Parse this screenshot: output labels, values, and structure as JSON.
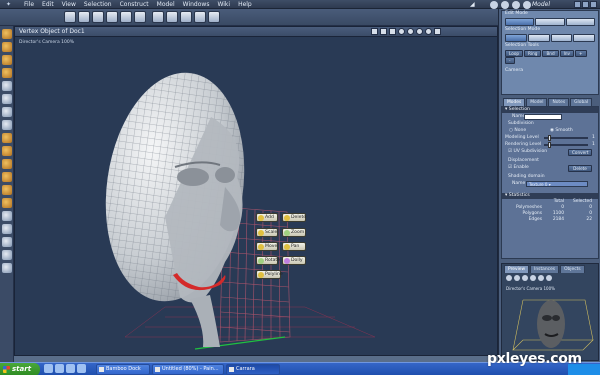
{
  "menubar": {
    "items": [
      "File",
      "Edit",
      "View",
      "Selection",
      "Construct",
      "Model",
      "Windows",
      "Wiki",
      "Help"
    ],
    "mode_label": "Model"
  },
  "viewport": {
    "title": "Vertex Object of Doc1",
    "camera_label": "Director's Camera 100%"
  },
  "popup_menu": {
    "items": [
      {
        "label": "Add",
        "color": "#e0c040"
      },
      {
        "label": "Delete",
        "color": "#e0c040"
      },
      {
        "label": "Scale",
        "color": "#e0c040"
      },
      {
        "label": "Zoom",
        "color": "#a0d080"
      },
      {
        "label": "Move",
        "color": "#e0c040"
      },
      {
        "label": "Pan",
        "color": "#e0c040"
      },
      {
        "label": "Rotate",
        "color": "#a0d080"
      },
      {
        "label": "Dolly",
        "color": "#c080e0"
      },
      {
        "label": "Polyline",
        "color": "#e0c040"
      }
    ]
  },
  "right_panel": {
    "edit_mode_label": "Edit Mode",
    "selection_mode_label": "Selection Mode",
    "selection_tools_label": "Selection Tools",
    "selection_tools": [
      "Loop",
      "Ring",
      "Bnd",
      "Inv",
      "+",
      "-"
    ],
    "camera_label": "Camera",
    "tabs": [
      "Modes",
      "Model",
      "Notes",
      "Global"
    ],
    "selection_section": "Selection",
    "name_label": "Name",
    "name_value": "",
    "subdivision_label": "Subdivision",
    "subdivision_none": "None",
    "subdivision_smooth": "Smooth",
    "modeling_level_label": "Modeling Level",
    "modeling_level_value": "1",
    "rendering_level_label": "Rendering Level",
    "rendering_level_value": "1",
    "uv_subdivision_label": "UV Subdivision",
    "convert_label": "Convert",
    "displacement_label": "Displacement",
    "enable_label": "Enable",
    "delete_label": "Delete",
    "shading_label": "Shading domain",
    "shading_name_label": "Name",
    "shading_name_value": "Texture 0",
    "statistics_section": "Statistics",
    "stats_headers": [
      "",
      "Total",
      "Selected"
    ],
    "stats_rows": [
      {
        "label": "Polymeshes",
        "total": "0",
        "selected": "0"
      },
      {
        "label": "Polygons",
        "total": "1100",
        "selected": "0"
      },
      {
        "label": "Edges",
        "total": "2184",
        "selected": "22"
      }
    ],
    "preview_tabs": [
      "Preview",
      "Instances",
      "Objects"
    ],
    "preview_camera_label": "Director's Camera 100%"
  },
  "taskbar": {
    "start_label": "start",
    "tasks": [
      "Bamboo Dock",
      "Untitled (80%) - Pain...",
      "Carrara"
    ]
  },
  "watermark": "pxleyes.com"
}
